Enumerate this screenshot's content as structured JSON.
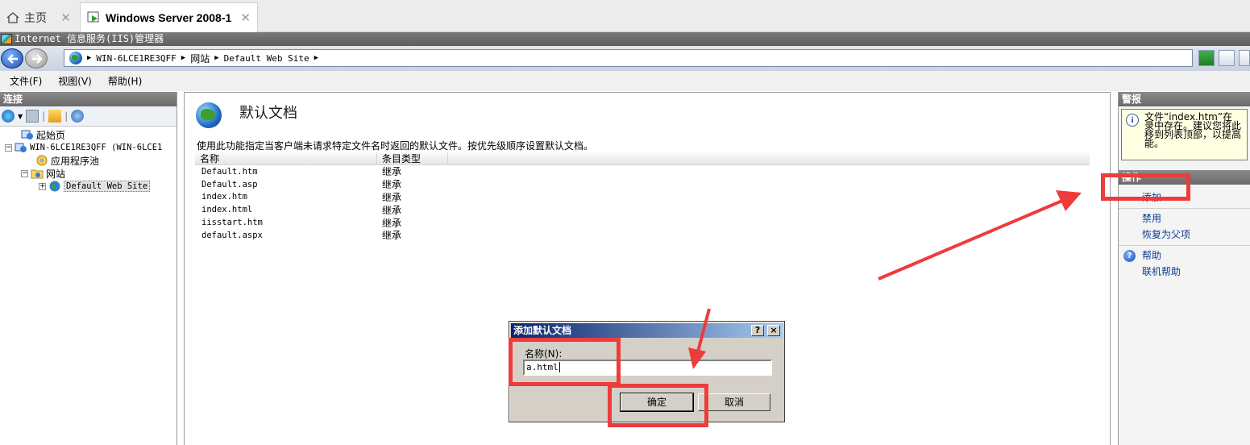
{
  "vm_tabs": {
    "home_label": "主页",
    "active_label": "Windows Server 2008-1"
  },
  "window": {
    "title": "Internet 信息服务(IIS)管理器"
  },
  "address": {
    "segments": [
      "WIN-6LCE1RE3QFF",
      "网站",
      "Default Web Site"
    ]
  },
  "menu": {
    "items": [
      "文件(F)",
      "视图(V)",
      "帮助(H)"
    ]
  },
  "connections": {
    "title": "连接",
    "tree": [
      {
        "label": "起始页"
      },
      {
        "label": "WIN-6LCE1RE3QFF (WIN-6LCE1"
      },
      {
        "label": "应用程序池"
      },
      {
        "label": "网站"
      },
      {
        "label": "Default Web Site"
      }
    ]
  },
  "main": {
    "title": "默认文档",
    "description": "使用此功能指定当客户端未请求特定文件名时返回的默认文件。按优先级顺序设置默认文档。",
    "columns": [
      "名称",
      "条目类型"
    ],
    "rows": [
      {
        "name": "Default.htm",
        "type": "继承"
      },
      {
        "name": "Default.asp",
        "type": "继承"
      },
      {
        "name": "index.htm",
        "type": "继承"
      },
      {
        "name": "index.html",
        "type": "继承"
      },
      {
        "name": "iisstart.htm",
        "type": "继承"
      },
      {
        "name": "default.aspx",
        "type": "继承"
      }
    ]
  },
  "alerts": {
    "title": "警报",
    "lines": [
      "文件“index.htm”在",
      "录中存在。建议您将此",
      "移到列表顶部，以提高",
      "能。"
    ]
  },
  "actions": {
    "title": "操作",
    "add": "添加...",
    "disable": "禁用",
    "revert": "恢复为父项",
    "help": "帮助",
    "online_help": "联机帮助"
  },
  "dialog": {
    "title": "添加默认文档",
    "help_btn": "?",
    "close_btn": "×",
    "name_label": "名称(N):",
    "name_value": "a.html",
    "ok": "确定",
    "cancel": "取消"
  }
}
